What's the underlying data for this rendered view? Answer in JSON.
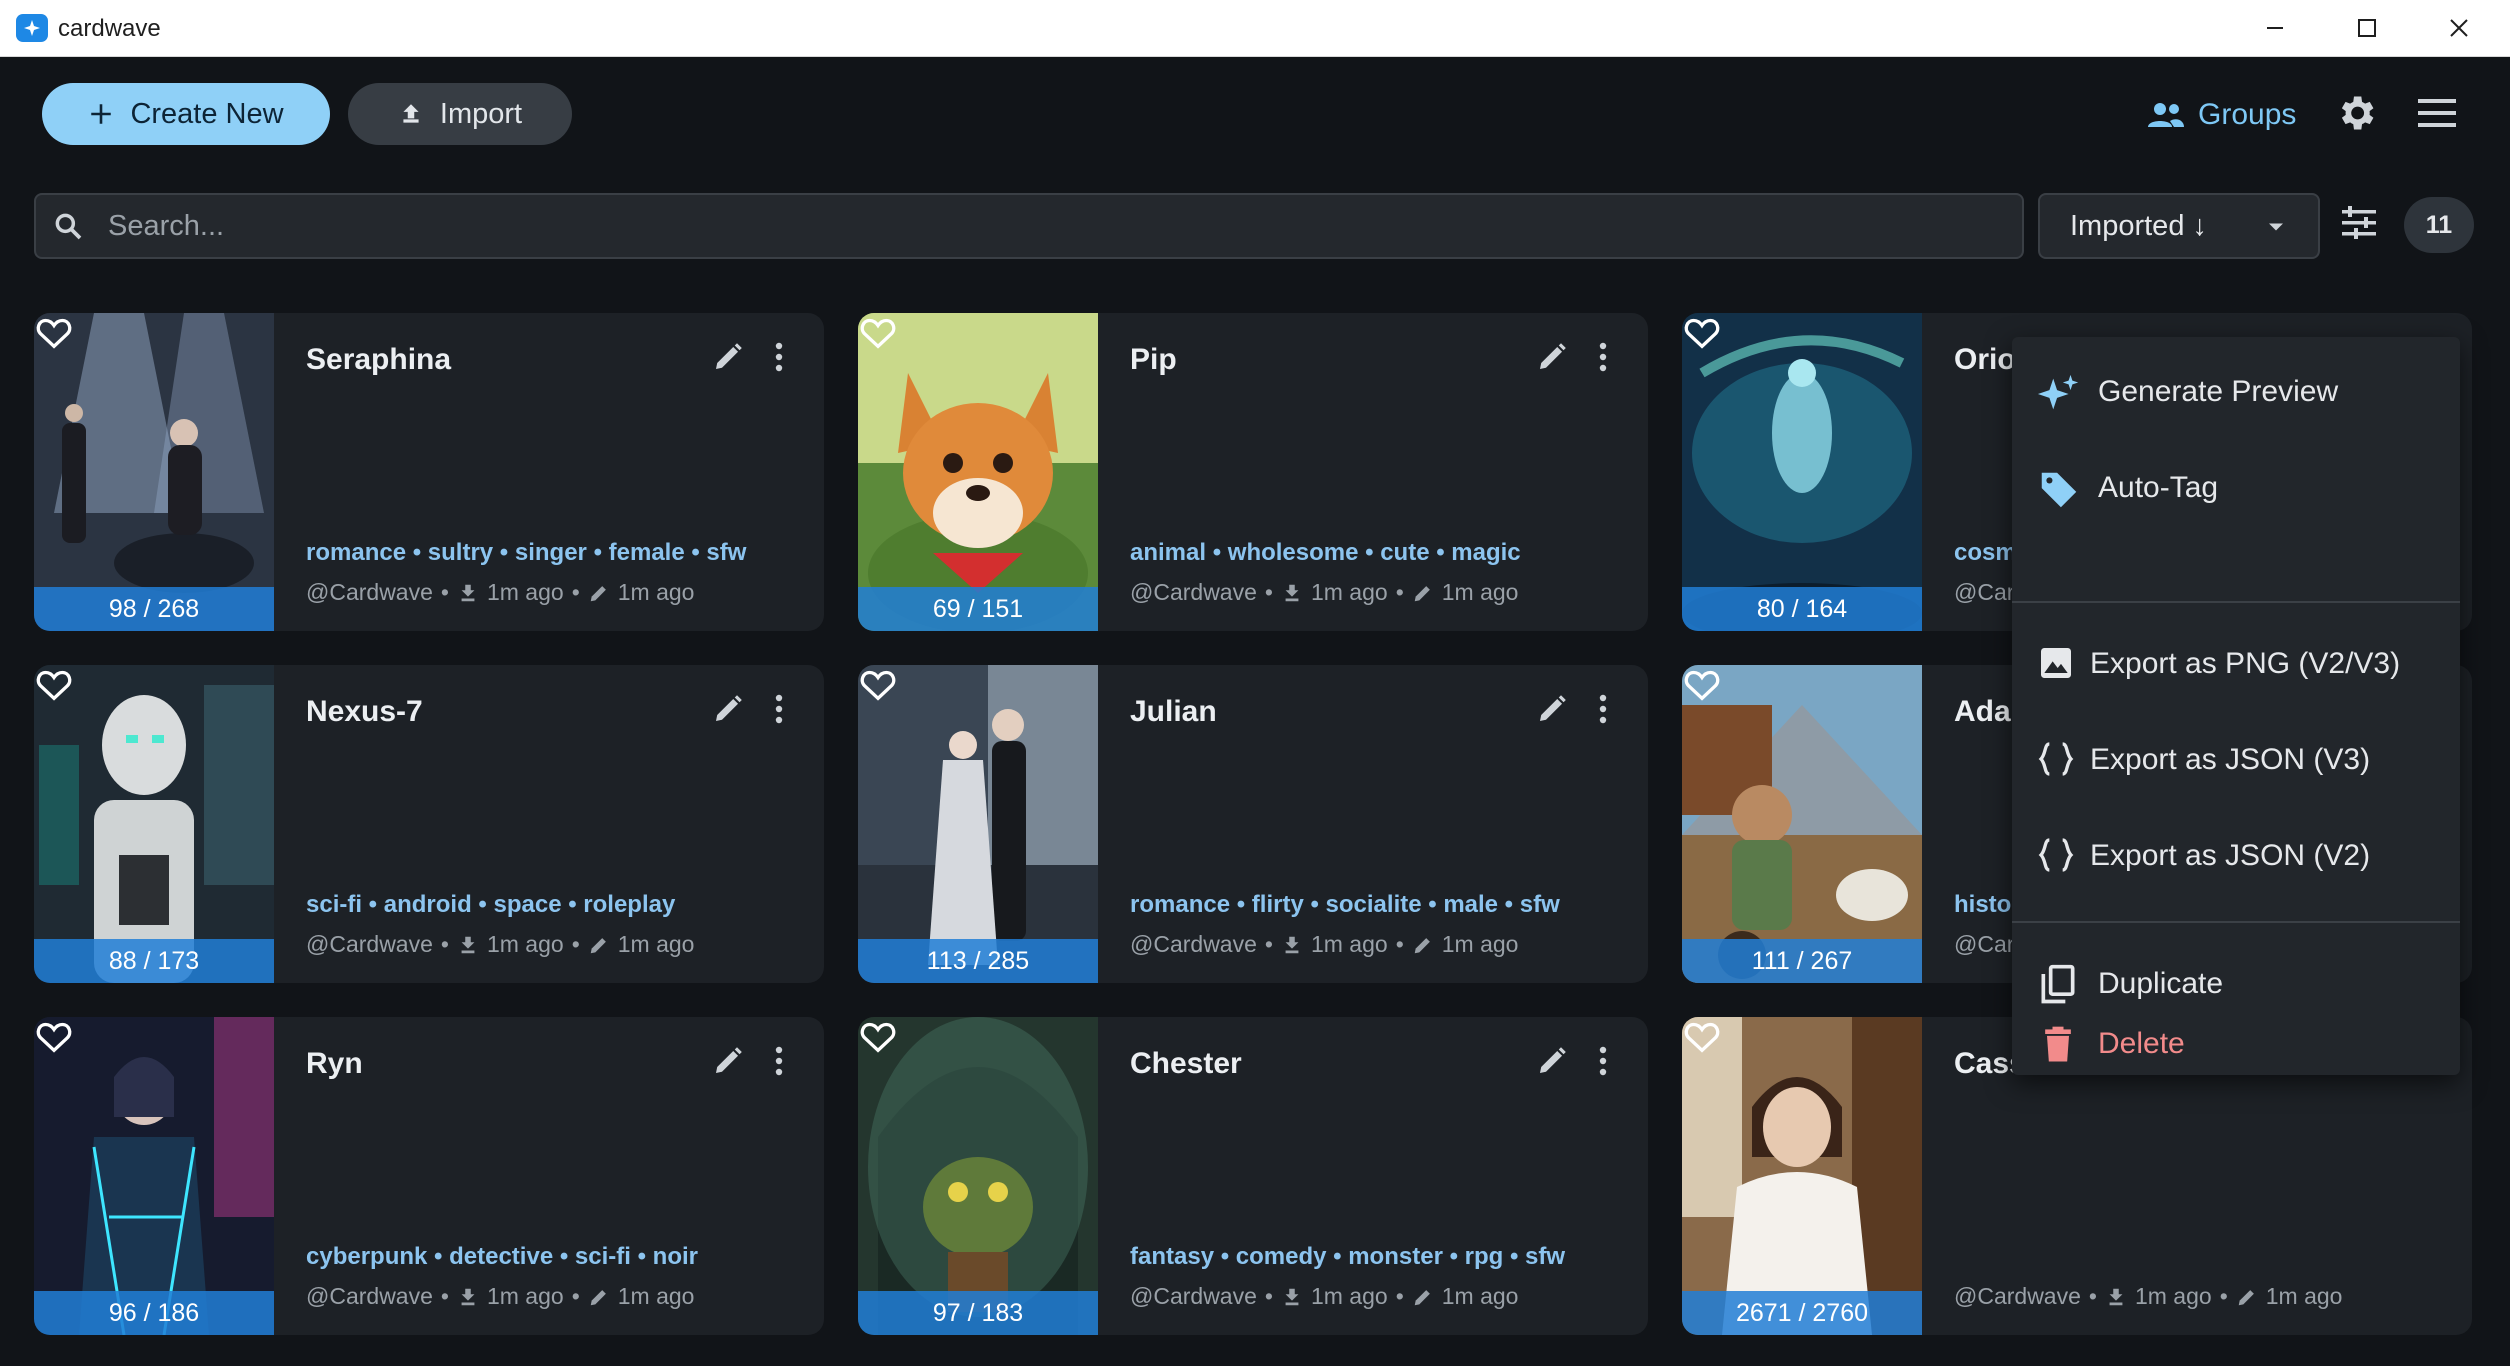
{
  "window": {
    "title": "cardwave",
    "controls": [
      "minimize-icon",
      "maximize-icon",
      "close-icon"
    ]
  },
  "toolbar": {
    "create_label": "Create New",
    "import_label": "Import",
    "groups_label": "Groups",
    "icons": [
      "add-icon",
      "upload-icon",
      "groups-icon",
      "gear-icon",
      "hamburger-menu-icon"
    ]
  },
  "search": {
    "placeholder": "Search...",
    "value": ""
  },
  "sort": {
    "label": "Imported ↓"
  },
  "filter": {
    "count": "11"
  },
  "colors": {
    "background": "#111418",
    "card": "#1d2126",
    "accent": "#8fd0f7",
    "tags": "#8cc4ef",
    "token_bar": "#217ed6",
    "danger": "#f28b8b"
  },
  "cards": [
    {
      "name": "Seraphina",
      "tokens": "98 / 268",
      "tags": "romance • sultry • singer • female • sfw",
      "author": "@Cardwave",
      "downloaded": "1m ago",
      "edited": "1m ago"
    },
    {
      "name": "Pip",
      "tokens": "69 / 151",
      "tags": "animal • wholesome • cute • magic",
      "author": "@Cardwave",
      "downloaded": "1m ago",
      "edited": "1m ago"
    },
    {
      "name": "Orio",
      "tokens": "80 / 164",
      "tags": "cosm",
      "author": "@Car",
      "downloaded": "",
      "edited": ""
    },
    {
      "name": "Nexus-7",
      "tokens": "88 / 173",
      "tags": "sci-fi • android • space • roleplay",
      "author": "@Cardwave",
      "downloaded": "1m ago",
      "edited": "1m ago"
    },
    {
      "name": "Julian",
      "tokens": "113 / 285",
      "tags": "romance • flirty • socialite • male • sfw",
      "author": "@Cardwave",
      "downloaded": "1m ago",
      "edited": "1m ago"
    },
    {
      "name": "Ada",
      "tokens": "111 / 267",
      "tags": "histo",
      "author": "@Car",
      "downloaded": "",
      "edited": ""
    },
    {
      "name": "Ryn",
      "tokens": "96 / 186",
      "tags": "cyberpunk • detective • sci-fi • noir",
      "author": "@Cardwave",
      "downloaded": "1m ago",
      "edited": "1m ago"
    },
    {
      "name": "Chester",
      "tokens": "97 / 183",
      "tags": "fantasy • comedy • monster • rpg • sfw",
      "author": "@Cardwave",
      "downloaded": "1m ago",
      "edited": "1m ago"
    },
    {
      "name": "Cass",
      "tokens": "2671 / 2760",
      "tags": "",
      "author": "@Cardwave",
      "downloaded": "1m ago",
      "edited": "1m ago"
    }
  ],
  "context_menu": {
    "items": [
      {
        "label": "Generate Preview",
        "icon": "sparkle-icon"
      },
      {
        "label": "Auto-Tag",
        "icon": "tag-icon"
      },
      {
        "label": "Export as PNG (V2/V3)",
        "icon": "image-icon"
      },
      {
        "label": "Export as JSON (V3)",
        "icon": "braces-icon"
      },
      {
        "label": "Export as JSON (V2)",
        "icon": "braces-icon"
      },
      {
        "label": "Duplicate",
        "icon": "copy-icon"
      },
      {
        "label": "Delete",
        "icon": "trash-icon"
      }
    ]
  }
}
